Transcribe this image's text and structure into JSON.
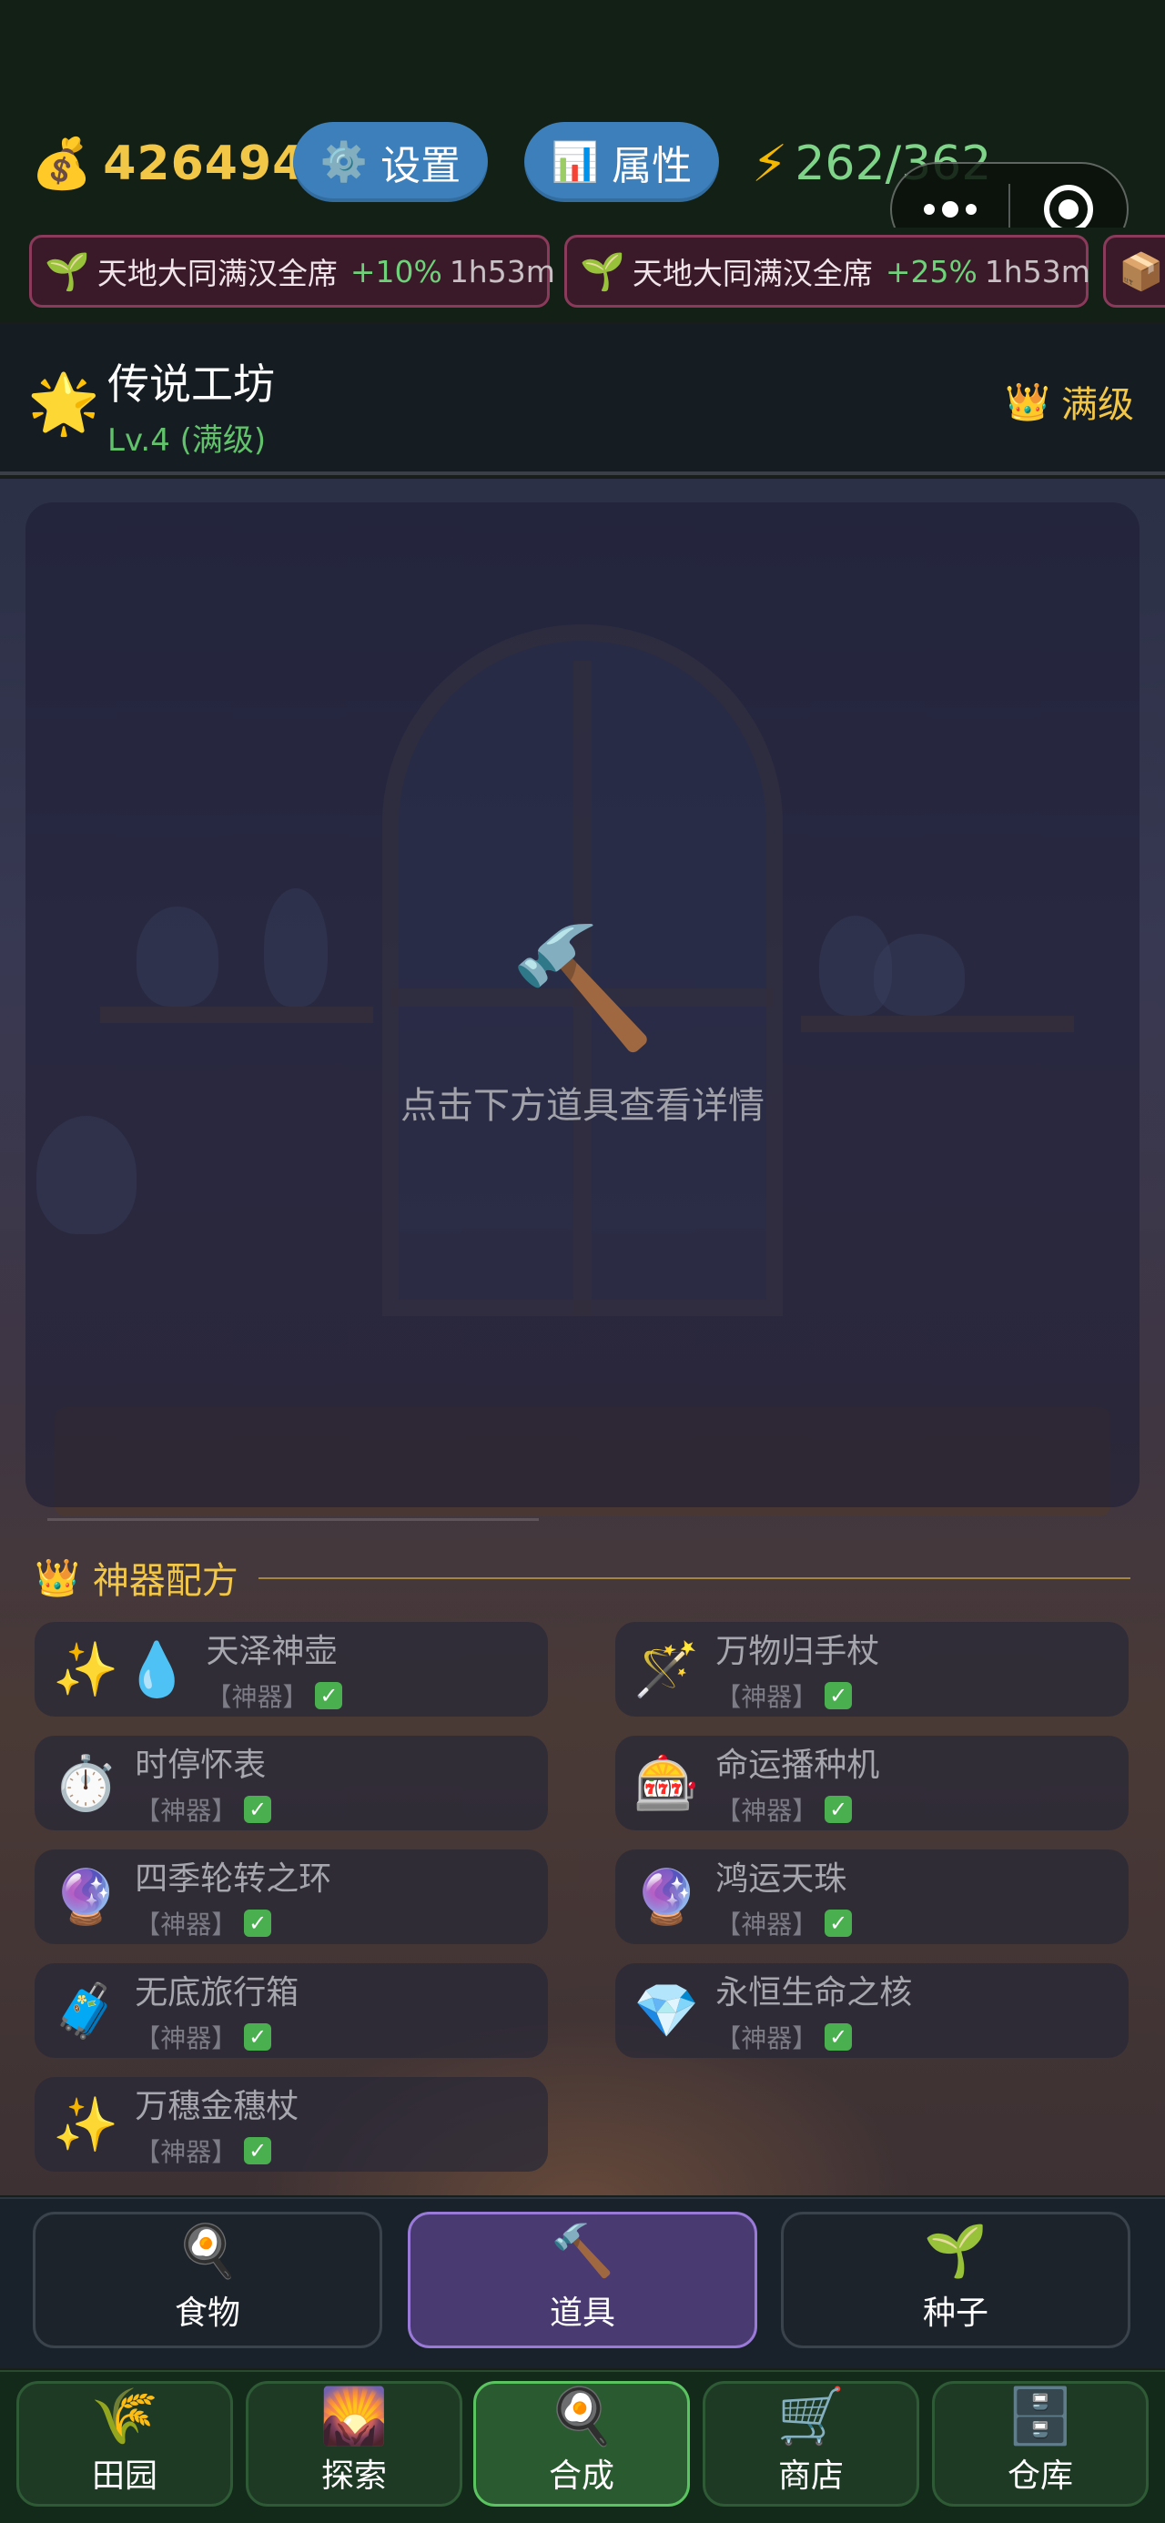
{
  "header": {
    "gold": "426494",
    "settings_label": "设置",
    "attributes_label": "属性",
    "energy": "262/362",
    "icons": {
      "gold": "money-bag-icon",
      "settings": "gear-icon",
      "attributes": "bar-chart-icon",
      "energy": "lightning-icon"
    }
  },
  "buffs": [
    {
      "name": "天地大同满汉全席",
      "bonus": "+10%",
      "time": "1h53m",
      "icon": "sprout-icon"
    },
    {
      "name": "天地大同满汉全席",
      "bonus": "+25%",
      "time": "1h53m",
      "icon": "sprout-icon"
    },
    {
      "icon": "package-icon"
    }
  ],
  "workshop": {
    "title": "传说工坊",
    "level": "Lv.4 (满级)",
    "max_label": "满级",
    "icons": {
      "title": "glowing-star-icon",
      "max": "crown-icon"
    }
  },
  "detail": {
    "hint": "点击下方道具查看详情",
    "icon": "hammer-icon"
  },
  "recipes_section": {
    "title": "神器配方",
    "items": [
      {
        "name": "天泽神壶",
        "tag": "【神器】",
        "icons": [
          "sparkles-icon",
          "droplet-icon"
        ]
      },
      {
        "name": "万物归手杖",
        "tag": "【神器】",
        "icons": [
          "magic-wand-icon"
        ]
      },
      {
        "name": "时停怀表",
        "tag": "【神器】",
        "icons": [
          "stopwatch-icon"
        ]
      },
      {
        "name": "命运播种机",
        "tag": "【神器】",
        "icons": [
          "slot-machine-icon"
        ]
      },
      {
        "name": "四季轮转之环",
        "tag": "【神器】",
        "icons": [
          "crystal-ball-icon"
        ]
      },
      {
        "name": "鸿运天珠",
        "tag": "【神器】",
        "icons": [
          "crystal-ball-icon"
        ]
      },
      {
        "name": "无底旅行箱",
        "tag": "【神器】",
        "icons": [
          "luggage-icon"
        ]
      },
      {
        "name": "永恒生命之核",
        "tag": "【神器】",
        "icons": [
          "gem-icon"
        ]
      },
      {
        "name": "万穗金穗杖",
        "tag": "【神器】",
        "icons": [
          "sparkles-icon"
        ]
      }
    ]
  },
  "category_tabs": [
    {
      "label": "食物",
      "icon": "frying-pan-icon",
      "selected": false
    },
    {
      "label": "道具",
      "icon": "hammer-icon",
      "selected": true
    },
    {
      "label": "种子",
      "icon": "sprout-icon",
      "selected": false
    }
  ],
  "bottom_nav": [
    {
      "label": "田园",
      "icon": "rice-icon",
      "selected": false
    },
    {
      "label": "探索",
      "icon": "sunrise-icon",
      "selected": false
    },
    {
      "label": "合成",
      "icon": "frying-pan-icon",
      "selected": true
    },
    {
      "label": "商店",
      "icon": "shopping-cart-icon",
      "selected": false
    },
    {
      "label": "仓库",
      "icon": "file-cabinet-icon",
      "selected": false
    }
  ],
  "colors": {
    "gold": "#f2c646",
    "energy": "#7fd48a",
    "button": "#3d7fba",
    "buff_border": "#8a3a5a",
    "selected_tab": "#9a7ad8",
    "selected_nav": "#5ac460"
  }
}
